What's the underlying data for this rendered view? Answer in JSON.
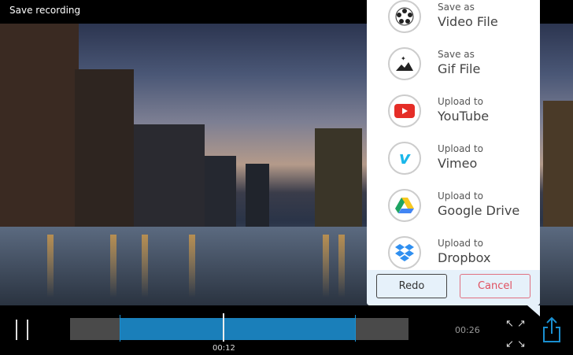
{
  "window": {
    "title": "Save recording"
  },
  "popup": {
    "items": [
      {
        "line1": "Save as",
        "line2": "Video File",
        "icon": "film-reel-icon"
      },
      {
        "line1": "Save as",
        "line2": "Gif File",
        "icon": "image-icon"
      },
      {
        "line1": "Upload to",
        "line2": "YouTube",
        "icon": "youtube-icon"
      },
      {
        "line1": "Upload to",
        "line2": "Vimeo",
        "icon": "vimeo-icon"
      },
      {
        "line1": "Upload to",
        "line2": "Google Drive",
        "icon": "google-drive-icon"
      },
      {
        "line1": "Upload to",
        "line2": "Dropbox",
        "icon": "dropbox-icon"
      }
    ],
    "redo": "Redo",
    "cancel": "Cancel"
  },
  "player": {
    "current_time": "00:12",
    "end_time": "00:26",
    "selection_start_fraction": 0.147,
    "selection_end_fraction": 0.845,
    "playhead_fraction": 0.453
  },
  "colors": {
    "accent": "#1a7fba",
    "cancel": "#e05060"
  }
}
